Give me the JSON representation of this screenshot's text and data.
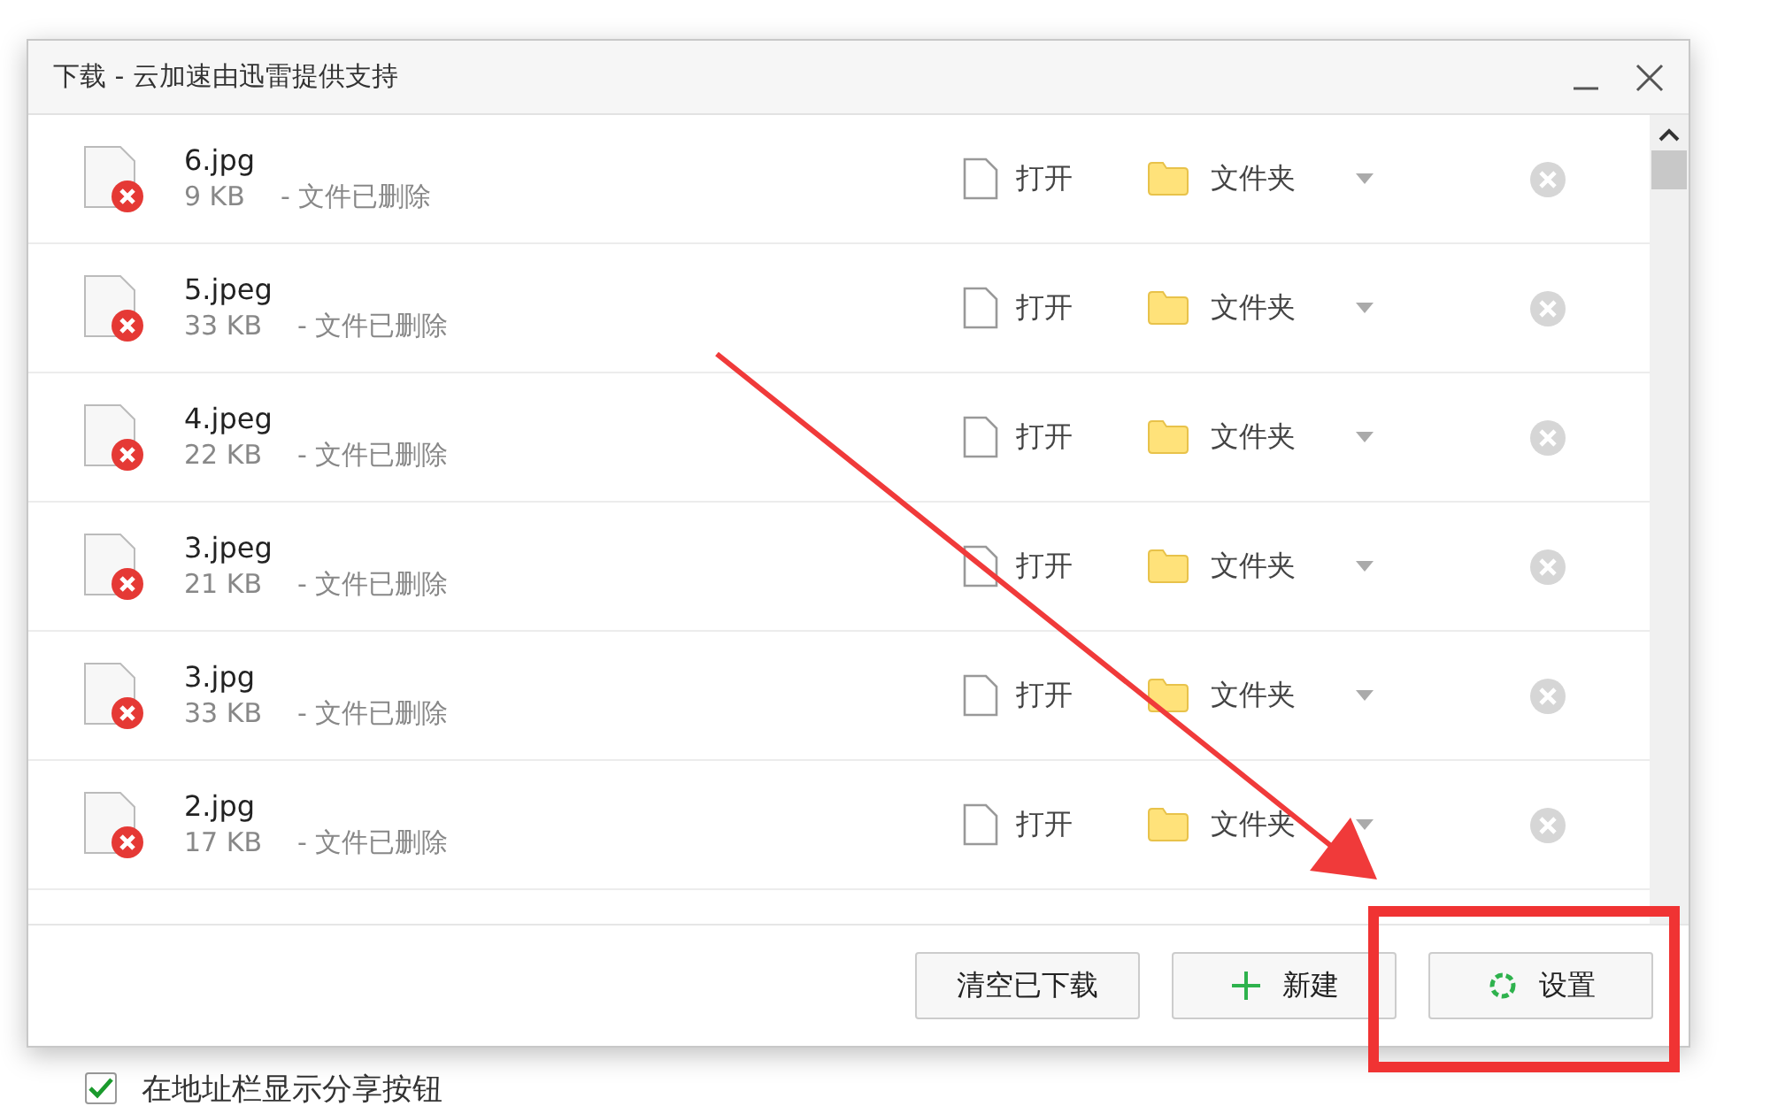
{
  "window": {
    "title": "下载 - 云加速由迅雷提供支持"
  },
  "downloads": [
    {
      "name": "6.jpg",
      "size": "9 KB",
      "status": "- 文件已删除",
      "open": "打开",
      "folder": "文件夹"
    },
    {
      "name": "5.jpeg",
      "size": "33 KB",
      "status": "- 文件已删除",
      "open": "打开",
      "folder": "文件夹"
    },
    {
      "name": "4.jpeg",
      "size": "22 KB",
      "status": "- 文件已删除",
      "open": "打开",
      "folder": "文件夹"
    },
    {
      "name": "3.jpeg",
      "size": "21 KB",
      "status": "- 文件已删除",
      "open": "打开",
      "folder": "文件夹"
    },
    {
      "name": "3.jpg",
      "size": "33 KB",
      "status": "- 文件已删除",
      "open": "打开",
      "folder": "文件夹"
    },
    {
      "name": "2.jpg",
      "size": "17 KB",
      "status": "- 文件已删除",
      "open": "打开",
      "folder": "文件夹"
    }
  ],
  "buttons": [
    {
      "kind": "clear",
      "label": "清空已下载"
    },
    {
      "kind": "new",
      "label": "新建"
    },
    {
      "kind": "settings",
      "label": "设置"
    }
  ],
  "background_settings": [
    {
      "checked": true,
      "label": "在地址栏显示分享按钮"
    }
  ]
}
